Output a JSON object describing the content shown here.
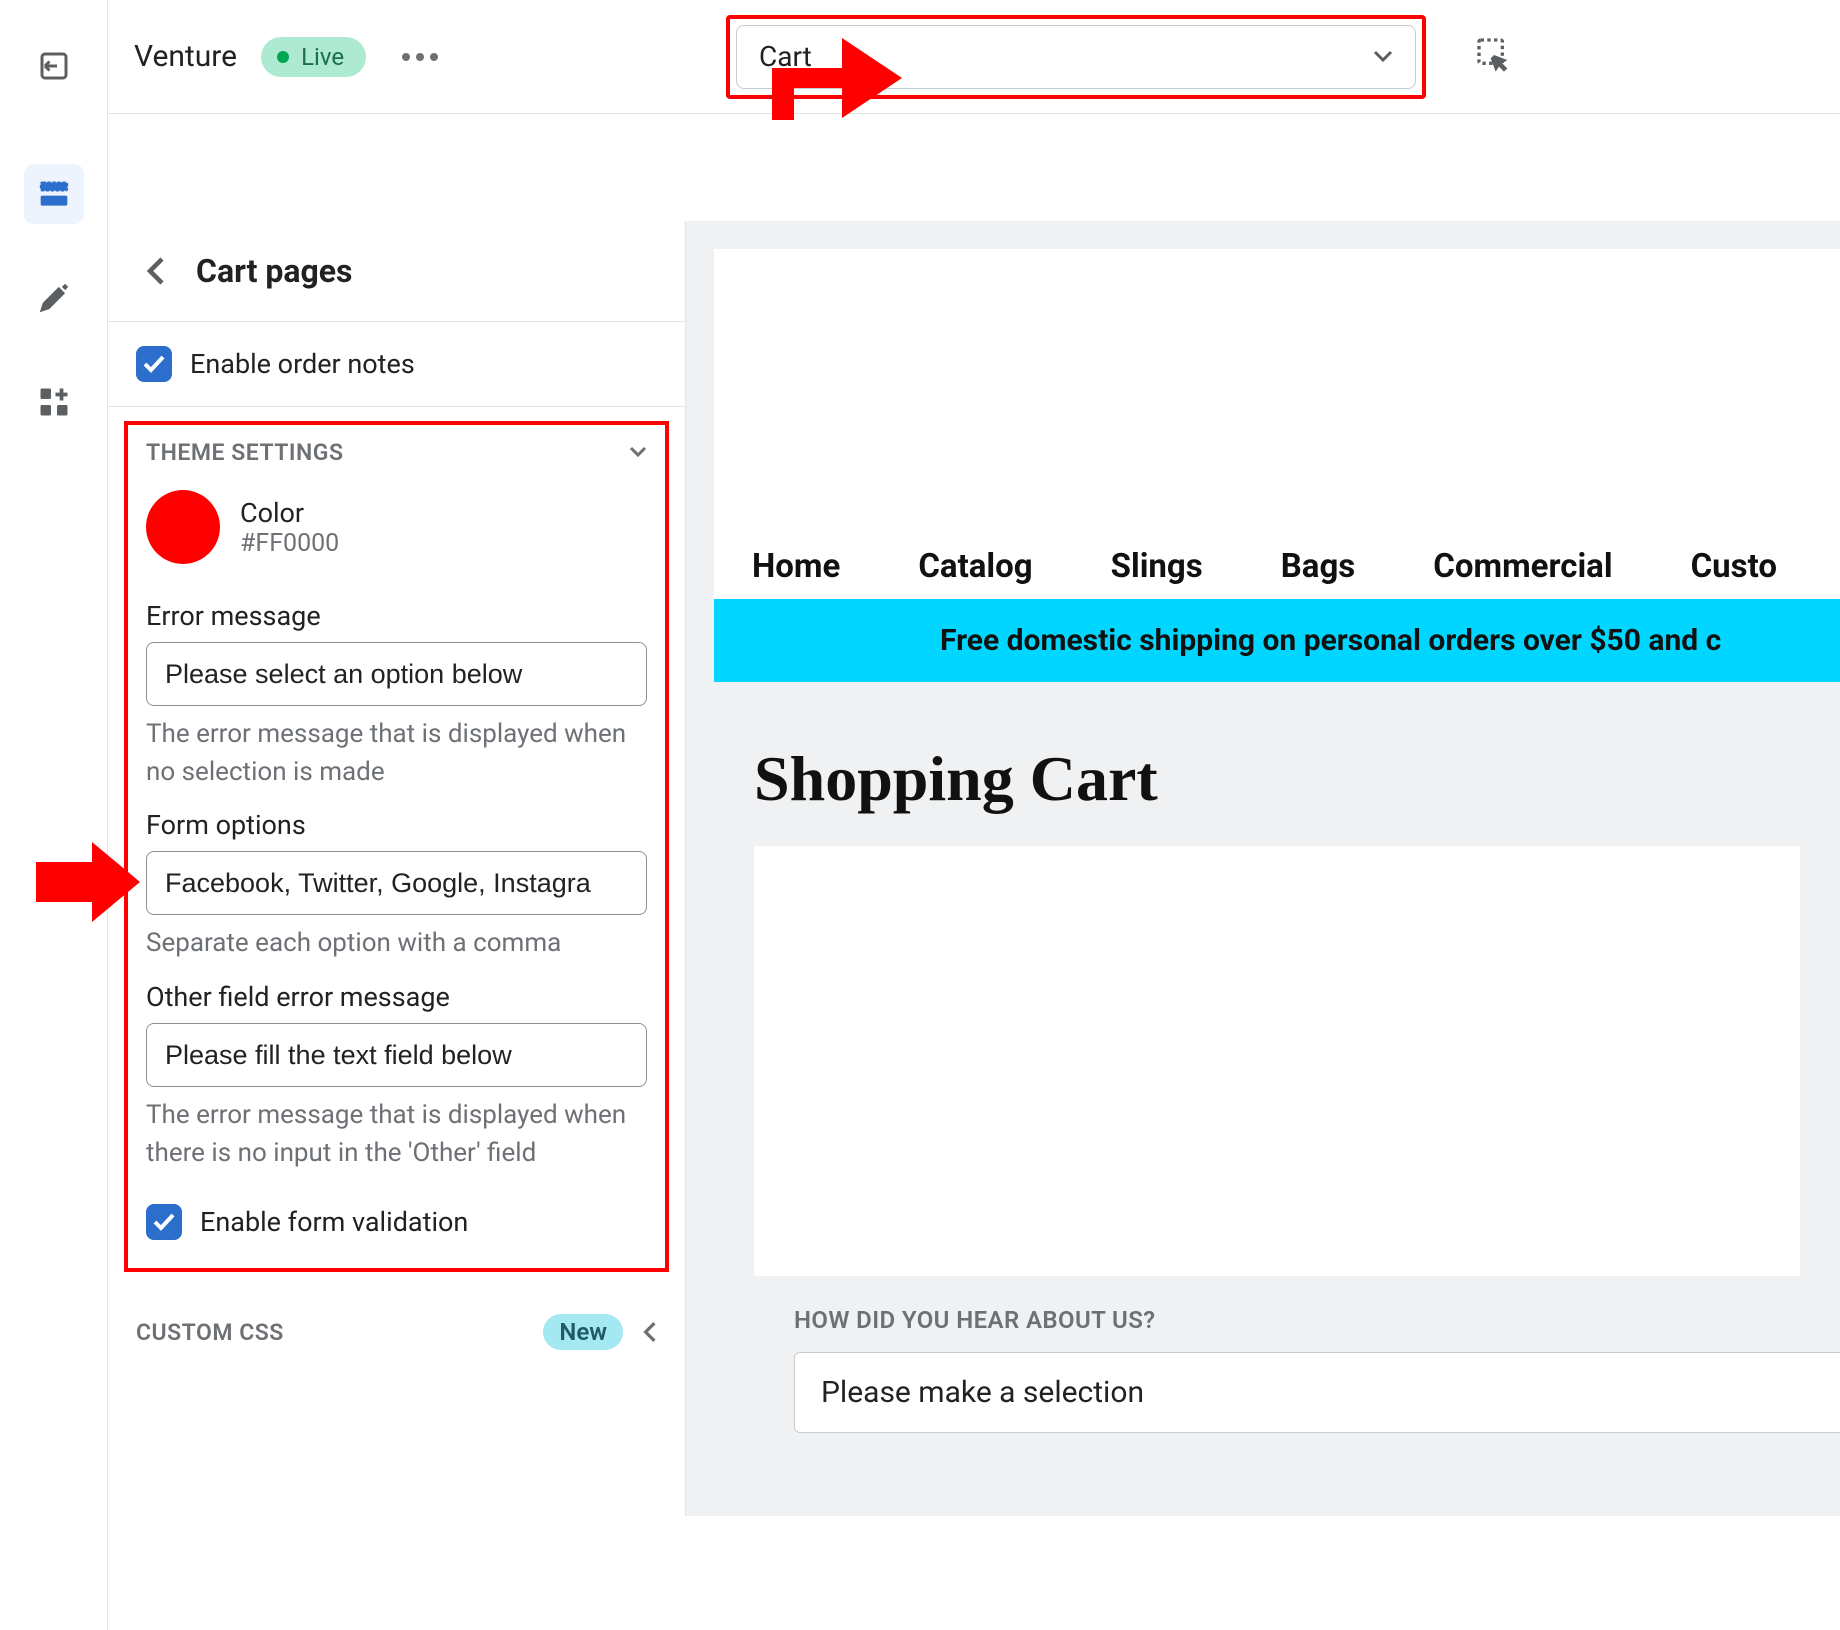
{
  "topbar": {
    "theme_name": "Venture",
    "live_label": "Live",
    "page_select_value": "Cart"
  },
  "sidebar": {
    "panel_title": "Cart pages",
    "enable_order_notes_label": "Enable order notes",
    "theme_settings_label": "THEME SETTINGS",
    "color": {
      "label": "Color",
      "hex": "#FF0000"
    },
    "error_message": {
      "label": "Error message",
      "value": "Please select an option below",
      "help": "The error message that is displayed when no selection is made"
    },
    "form_options": {
      "label": "Form options",
      "value": "Facebook, Twitter, Google, Instagra",
      "help": "Separate each option with a comma"
    },
    "other_error": {
      "label": "Other field error message",
      "value": "Please fill the text field below",
      "help": "The error message that is displayed when there is no input in the 'Other' field"
    },
    "enable_form_validation_label": "Enable form validation",
    "custom_css_label": "CUSTOM CSS",
    "new_badge": "New"
  },
  "preview": {
    "nav": [
      "Home",
      "Catalog",
      "Slings",
      "Bags",
      "Commercial",
      "Custo"
    ],
    "banner": "Free domestic shipping on personal orders over $50 and c",
    "cart_title": "Shopping Cart",
    "survey_label": "HOW DID YOU HEAR ABOUT US?",
    "survey_placeholder": "Please make a selection"
  }
}
